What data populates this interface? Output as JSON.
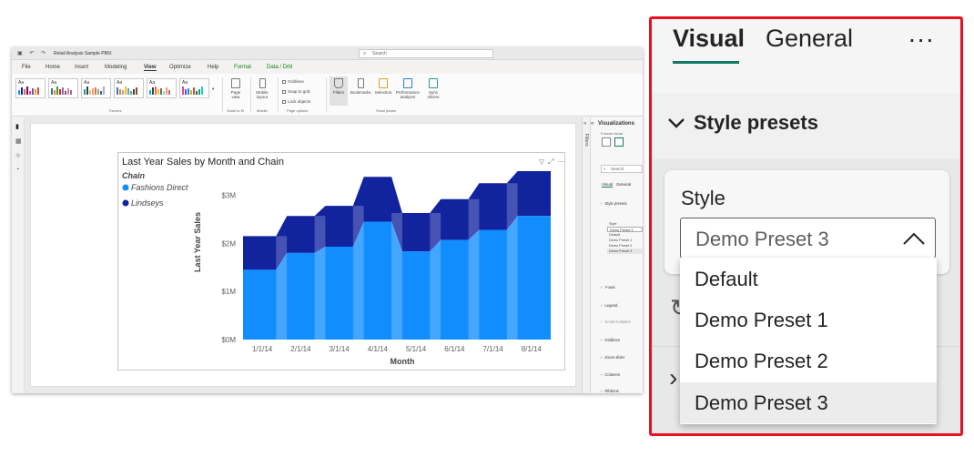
{
  "app": {
    "window_title": "Retail Analysis Sample PBIX",
    "search_placeholder": "Search",
    "menu": [
      "File",
      "Home",
      "Insert",
      "Modeling",
      "View",
      "Optimize",
      "Help",
      "Format",
      "Data / Drill"
    ],
    "active_menu": "View",
    "ribbon": {
      "themes_label": "Themes",
      "page_view_label": "Page view",
      "scale_to_fit_label": "Scale to fit",
      "mobile_layout_label": "Mobile layout",
      "mobile_group_label": "Mobile",
      "gridlines_label": "Gridlines",
      "snap_to_grid_label": "Snap to grid",
      "lock_objects_label": "Lock objects",
      "page_options_label": "Page options",
      "filters_label": "Filters",
      "bookmarks_label": "Bookmarks",
      "selection_label": "Selection",
      "performance_analyzer_label": "Performance analyzer",
      "sync_slicers_label": "Sync slicers",
      "show_panes_label": "Show panes",
      "theme_swatch_text": "Aa"
    },
    "filters_pane_label": "Filters",
    "visualizations_pane": {
      "title": "Visualizations",
      "format_visual_label": "Format visual",
      "search_placeholder": "Search",
      "tab_visual": "Visual",
      "tab_general": "General",
      "style_presets_label": "Style presets",
      "style_label": "Style",
      "style_value": "Demo Preset 3",
      "options": [
        "Default",
        "Demo Preset 1",
        "Demo Preset 2",
        "Demo Preset 3"
      ],
      "sections": [
        "Y-axis",
        "Legend",
        "Small multiples",
        "Gridlines",
        "Zoom slider",
        "Columns",
        "Ribbons"
      ]
    }
  },
  "chart_data": {
    "type": "area",
    "title": "Last Year Sales by Month and Chain",
    "legend_title": "Chain",
    "legend_placement": "top-left",
    "xlabel": "Month",
    "ylabel": "Last Year Sales",
    "categories": [
      "1/1/14",
      "2/1/14",
      "3/1/14",
      "4/1/14",
      "5/1/14",
      "6/1/14",
      "7/1/14",
      "8/1/14"
    ],
    "y_ticks": [
      "$0M",
      "$1M",
      "$2M",
      "$3M"
    ],
    "ylim": [
      0,
      3.5
    ],
    "stacked": true,
    "series": [
      {
        "name": "Fashions Direct",
        "color": "#118dff",
        "values": [
          1.45,
          1.8,
          1.93,
          2.45,
          1.83,
          2.07,
          2.28,
          2.57
        ]
      },
      {
        "name": "Lindseys",
        "color": "#12239e",
        "values": [
          0.7,
          0.77,
          0.85,
          0.93,
          0.8,
          0.85,
          0.97,
          0.93
        ]
      }
    ]
  },
  "zoom_panel": {
    "tab_visual": "Visual",
    "tab_general": "General",
    "more_label": "...",
    "section_title": "Style presets",
    "style_label": "Style",
    "style_value": "Demo Preset 3",
    "options": [
      "Default",
      "Demo Preset 1",
      "Demo Preset 2",
      "Demo Preset 3"
    ],
    "selected_option": "Demo Preset 3",
    "accent_color": "#117865",
    "highlight_border_color": "#e81123"
  }
}
